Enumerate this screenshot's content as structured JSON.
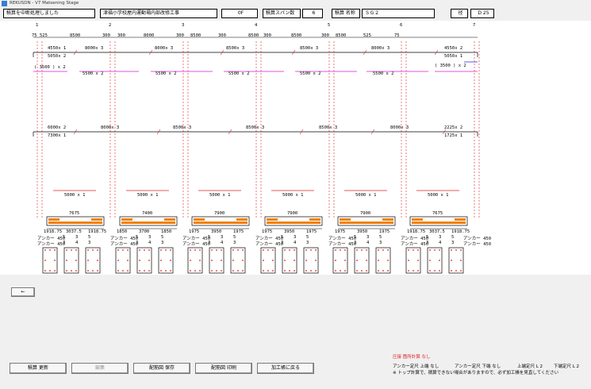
{
  "window": {
    "title": "REKUSDN - V7 Matsening Stage"
  },
  "toolbar": {
    "status": "積算を中断処理しました",
    "project": "津福小学校屋内運動場内部改修工事",
    "floor": "0F",
    "span_label": "積算スパン数",
    "span_count": "6",
    "name_label": "積算 名称",
    "name_value": "ＳＧ２",
    "dia_label": "径",
    "dia_value": "D 25"
  },
  "drawing": {
    "grid_labels": [
      "1",
      "2",
      "3",
      "4",
      "5",
      "6",
      "7"
    ],
    "top_dims": [
      "75",
      "525",
      "8500",
      "300",
      "300",
      "8000",
      "300",
      "8500",
      "300",
      "8500",
      "300",
      "8500",
      "300",
      "8500",
      "525",
      "75"
    ],
    "upper_bars": [
      "4550x 1",
      "5050x 2",
      "8000x 3",
      "8000x 3",
      "8500x 3",
      "8500x 3",
      "8000x 3",
      "4550x 2",
      "5050x 1"
    ],
    "upper_sub": [
      "( 3500 ) x 2",
      "5500 x 2",
      "5500 x 2",
      "5500 x 2",
      "5500 x 2",
      "5500 x 2",
      "( 3500 ) x 2"
    ],
    "lower_bars": [
      "6000x 2",
      "7300x 1",
      "8000x 3",
      "8500x 3",
      "8500x 3",
      "8500x 3",
      "8000x 3",
      "2225x 2",
      "1725x 1"
    ],
    "stirrups": [
      "5000 x 1",
      "5000 x 1",
      "5000 x 1",
      "5000 x 1",
      "5000 x 1",
      "5000 x 1"
    ],
    "beam_lengths": [
      "7675",
      "7400",
      "7900",
      "7900",
      "7900",
      "7675"
    ],
    "beam_dims": [
      [
        "1918.75",
        "3037.5",
        "1918.75"
      ],
      [
        "1850",
        "3700",
        "1850"
      ],
      [
        "1975",
        "3950",
        "1975"
      ],
      [
        "1975",
        "3950",
        "1975"
      ],
      [
        "1975",
        "3950",
        "1975"
      ],
      [
        "1918.75",
        "3037.5",
        "1918.75"
      ]
    ],
    "anchor_label": "アンカー 450",
    "anchor_values": [
      "5",
      "3",
      "5"
    ],
    "anchor_values2": [
      "3",
      "4",
      "3"
    ]
  },
  "nav": {
    "prev_label": "←"
  },
  "notes": {
    "warning": "圧接 箇所計算  なし",
    "anchor_top": "アンカー定尺 上端  なし",
    "anchor_bottom": "アンカー定尺 下端  なし",
    "upper_std": "上端定尺  L 2",
    "lower_std": "下端定尺  L 2",
    "caution": "※ トップ計算で、積算できない場合がありますので、必ず加工帳を見直してください"
  },
  "buttons": {
    "update": "積算 更新",
    "edit": "編集",
    "save": "配筋図 保存",
    "print": "配筋図 印刷",
    "back": "加工帳に戻る"
  },
  "colors": {
    "red": "#e02020",
    "magenta": "#d020d0",
    "orange": "#f08000",
    "blue": "#2020e0"
  }
}
